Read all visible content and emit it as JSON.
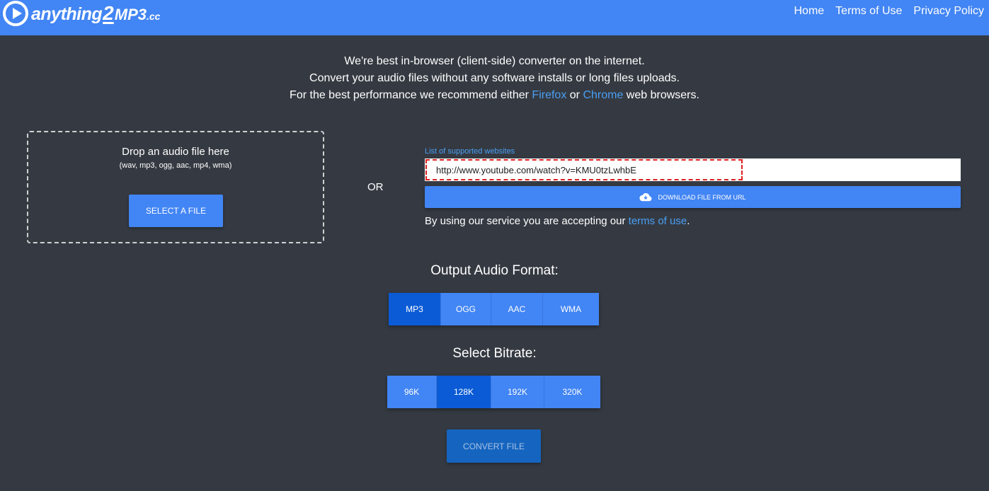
{
  "header": {
    "logo": {
      "part1": "anything",
      "part2": "2",
      "part3": "MP3",
      "part4": ".cc"
    },
    "nav": [
      {
        "label": "Home"
      },
      {
        "label": "Terms of Use"
      },
      {
        "label": "Privacy Policy"
      }
    ]
  },
  "intro": {
    "line1": "We're best in-browser (client-side) converter on the internet.",
    "line2": "Convert your audio files without any software installs or long files uploads.",
    "line3_prefix": "For the best performance we recommend either ",
    "firefox": "Firefox",
    "or_word": " or ",
    "chrome": "Chrome",
    "line3_suffix": " web browsers."
  },
  "dropzone": {
    "title": "Drop an audio file here",
    "formats": "(wav, mp3, ogg, aac, mp4, wma)",
    "button": "SELECT A FILE"
  },
  "or_label": "OR",
  "url_section": {
    "supported_link": "List of supported websites",
    "url_value": "http://www.youtube.com/watch?v=KMU0tzLwhbE",
    "download_button": "DOWNLOAD FILE FROM URL",
    "terms_prefix": "By using our service you are accepting our ",
    "terms_link": "terms of use",
    "terms_suffix": "."
  },
  "output_format": {
    "title": "Output Audio Format:",
    "options": [
      "MP3",
      "OGG",
      "AAC",
      "WMA"
    ],
    "selected": "MP3"
  },
  "bitrate": {
    "title": "Select Bitrate:",
    "options": [
      "96K",
      "128K",
      "192K",
      "320K"
    ],
    "selected": "128K"
  },
  "convert_button": "CONVERT FILE",
  "colors": {
    "accent": "#4285f4",
    "accent_active": "#0b5bd6",
    "background": "#353a42",
    "link": "#4a9ff5"
  }
}
